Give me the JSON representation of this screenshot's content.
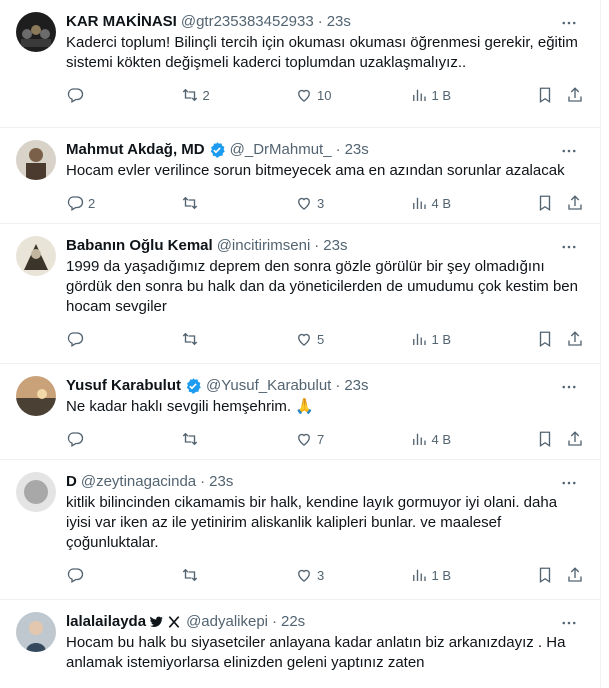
{
  "tweets": [
    {
      "name": "KAR MAKİNASI",
      "handle": "@gtr235383452933",
      "dot": "·",
      "time": "23s",
      "verified": false,
      "text": "Kaderci toplum! Bilinçli tercih için okuması okuması öğrenmesi gerekir, eğitim sistemi kökten değişmeli kaderci toplumdan uzaklaşmalıyız..",
      "replies": "",
      "retweets": "2",
      "likes": "10",
      "views": "1 B"
    },
    {
      "name": "Mahmut Akdağ, MD",
      "handle": "@_DrMahmut_",
      "dot": "·",
      "time": "23s",
      "verified": true,
      "text": "Hocam evler verilince sorun bitmeyecek ama  en azından sorunlar azalacak",
      "replies": "2",
      "retweets": "",
      "likes": "3",
      "views": "4 B"
    },
    {
      "name": "Babanın Oğlu Kemal",
      "handle": "@incitirimseni",
      "dot": "·",
      "time": "23s",
      "verified": false,
      "text": "1999 da yaşadığımız deprem den sonra gözle görülür bir şey olmadığını gördük den sonra bu halk dan da yöneticilerden de umudumu çok kestim ben hocam sevgiler",
      "replies": "",
      "retweets": "",
      "likes": "5",
      "views": "1 B"
    },
    {
      "name": "Yusuf Karabulut",
      "handle": "@Yusuf_Karabulut",
      "dot": "·",
      "time": "23s",
      "verified": true,
      "text": "Ne kadar haklı sevgili hemşehrim.",
      "emoji": "🙏",
      "replies": "",
      "retweets": "",
      "likes": "7",
      "views": "4 B"
    },
    {
      "name": "D",
      "handle": "@zeytinagacinda",
      "dot": "·",
      "time": "23s",
      "verified": false,
      "text": "kitlik bilincinden cikamamis bir halk, kendine layık gormuyor iyi olani. daha iyisi var iken az ile yetinirim aliskanlik kalipleri bunlar. ve maalesef çoğunluktalar.",
      "replies": "",
      "retweets": "",
      "likes": "3",
      "views": "1 B"
    },
    {
      "name": "lalalailayda",
      "handle": "@adyalikepi",
      "dot": "·",
      "time": "22s",
      "verified": false,
      "text": "Hocam bu halk bu siyasetciler anlayana kadar anlatın biz arkanızdayız . Ha anlamak istemiyorlarsa elinizden geleni yaptınız zaten",
      "replies": "",
      "retweets": "",
      "likes": "",
      "views": ""
    }
  ],
  "colors": {
    "text": "#0f1419",
    "secondary": "#536471",
    "verified": "#1d9bf0",
    "border": "#eff3f4"
  }
}
